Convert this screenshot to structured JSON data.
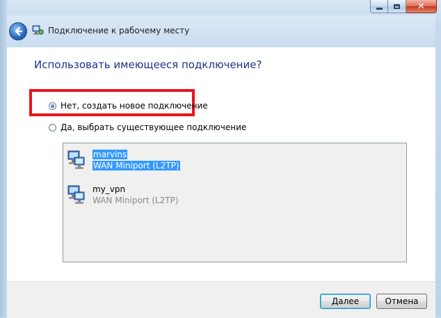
{
  "window": {
    "title": "Подключение к рабочему месту",
    "caption_close": "✕"
  },
  "content": {
    "heading": "Использовать имеющееся подключение?",
    "options": [
      {
        "label": "Нет, создать новое подключение",
        "checked": true
      },
      {
        "label": "Да, выбрать существующее подключение",
        "checked": false
      }
    ],
    "connections": [
      {
        "name": "marvins",
        "type": "WAN Miniport (L2TP)",
        "selected": true,
        "icon": "network-connection-icon"
      },
      {
        "name": "my_vpn",
        "type": "WAN Miniport (L2TP)",
        "selected": false,
        "icon": "network-connection-icon"
      }
    ]
  },
  "footer": {
    "next_label": "Далее",
    "cancel_label": "Отмена"
  },
  "colors": {
    "heading": "#1e3287",
    "selection": "#3399ff",
    "highlight_box": "#e8141b"
  }
}
